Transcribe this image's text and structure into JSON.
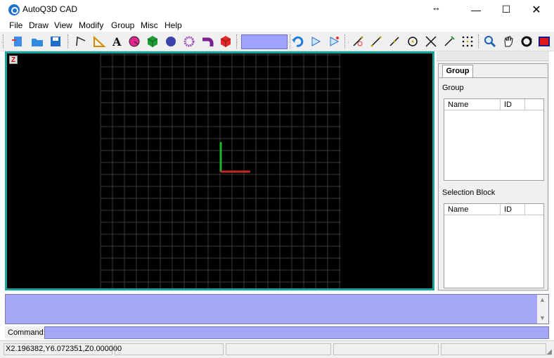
{
  "window": {
    "title": "AutoQ3D CAD",
    "resize_glyph": "↔",
    "minimize_glyph": "—",
    "maximize_glyph": "☐",
    "close_glyph": "✕"
  },
  "menu": [
    "File",
    "Draw",
    "View",
    "Modify",
    "Group",
    "Misc",
    "Help"
  ],
  "toolbar": {
    "icons": [
      "new-icon",
      "open-folder-icon",
      "save-icon",
      "polyline-icon",
      "dimension-icon",
      "text-icon",
      "sphere-pink-icon",
      "cube-icon",
      "sphere-icon",
      "torus-icon",
      "pipe-icon",
      "box-red-icon",
      "undo-icon",
      "play-icon",
      "play-select-icon",
      "line-point-icon",
      "line-icon",
      "line-edit-icon",
      "circle-icon",
      "cross-icon",
      "trim-icon",
      "point-grid-icon",
      "zoom-icon",
      "pan-hand-icon",
      "rotate-icon",
      "render-icon"
    ],
    "layer_color": "#9fa3ff"
  },
  "viewport": {
    "badge": "Z",
    "background": "#000000",
    "border_color": "#1aa39a",
    "grid_color": "#3a3a3a",
    "x_axis_color": "#c0282a",
    "y_axis_color": "#22b22a"
  },
  "right_panel": {
    "tab_label": "Group",
    "group_label": "Group",
    "selection_label": "Selection Block",
    "columns": [
      "Name",
      "ID"
    ]
  },
  "command": {
    "label": "Command:",
    "value": "",
    "output_color": "#a6a6f7"
  },
  "status": {
    "coords": "X2.196382,Y6.072351,Z0.000000"
  }
}
